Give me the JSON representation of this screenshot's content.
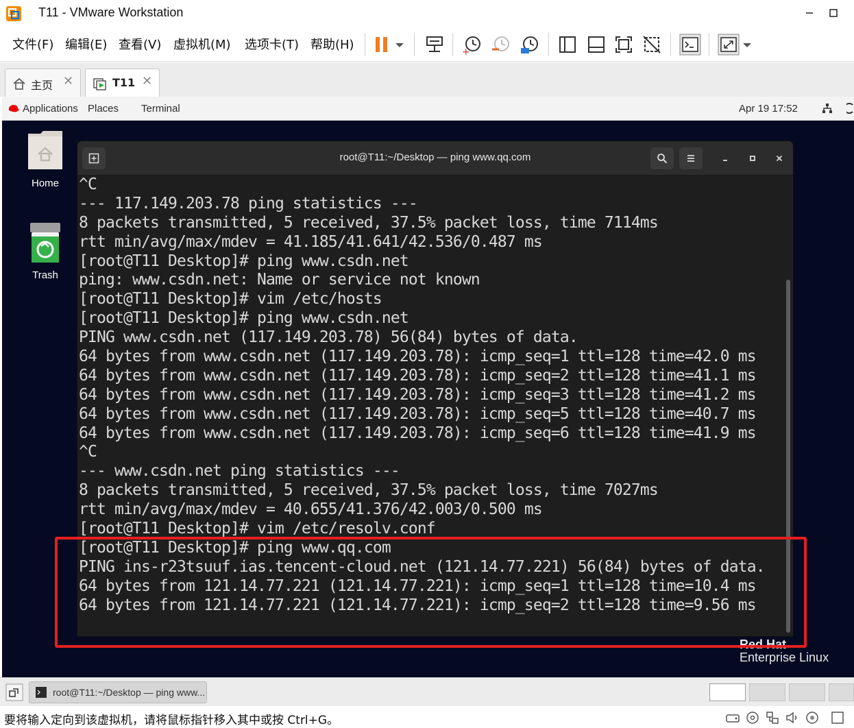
{
  "window": {
    "title": "T11 - VMware Workstation"
  },
  "menu": [
    "文件(F)",
    "编辑(E)",
    "查看(V)",
    "虚拟机(M)",
    "选项卡(T)",
    "帮助(H)"
  ],
  "tabs": [
    {
      "label": "主页"
    },
    {
      "label": "T11"
    }
  ],
  "guest_topbar": {
    "applications": "Applications",
    "places": "Places",
    "terminal": "Terminal",
    "datetime": "Apr 19  17:52"
  },
  "desktop": {
    "home_label": "Home",
    "trash_label": "Trash",
    "brand_line1": "Red Hat",
    "brand_line2": "Enterprise Linux"
  },
  "terminal": {
    "title": "root@T11:~/Desktop — ping www.qq.com",
    "lines": [
      "^C",
      "--- 117.149.203.78 ping statistics ---",
      "8 packets transmitted, 5 received, 37.5% packet loss, time 7114ms",
      "rtt min/avg/max/mdev = 41.185/41.641/42.536/0.487 ms",
      "[root@T11 Desktop]# ping www.csdn.net",
      "ping: www.csdn.net: Name or service not known",
      "[root@T11 Desktop]# vim /etc/hosts",
      "[root@T11 Desktop]# ping www.csdn.net",
      "PING www.csdn.net (117.149.203.78) 56(84) bytes of data.",
      "64 bytes from www.csdn.net (117.149.203.78): icmp_seq=1 ttl=128 time=42.0 ms",
      "64 bytes from www.csdn.net (117.149.203.78): icmp_seq=2 ttl=128 time=41.1 ms",
      "64 bytes from www.csdn.net (117.149.203.78): icmp_seq=3 ttl=128 time=41.2 ms",
      "64 bytes from www.csdn.net (117.149.203.78): icmp_seq=5 ttl=128 time=40.7 ms",
      "64 bytes from www.csdn.net (117.149.203.78): icmp_seq=6 ttl=128 time=41.9 ms",
      "^C",
      "--- www.csdn.net ping statistics ---",
      "8 packets transmitted, 5 received, 37.5% packet loss, time 7027ms",
      "rtt min/avg/max/mdev = 40.655/41.376/42.003/0.500 ms",
      "[root@T11 Desktop]# vim /etc/resolv.conf",
      "[root@T11 Desktop]# ping www.qq.com",
      "PING ins-r23tsuuf.ias.tencent-cloud.net (121.14.77.221) 56(84) bytes of data.",
      "64 bytes from 121.14.77.221 (121.14.77.221): icmp_seq=1 ttl=128 time=10.4 ms",
      "64 bytes from 121.14.77.221 (121.14.77.221): icmp_seq=2 ttl=128 time=9.56 ms"
    ]
  },
  "taskbar": {
    "task_label": "root@T11:~/Desktop — ping www..."
  },
  "statusbar": {
    "message": "要将输入定向到该虚拟机，请将鼠标指针移入其中或按 Ctrl+G。"
  },
  "colors": {
    "highlight": "#e51f1f",
    "pause_orange": "#f07d22",
    "desktop_bg": "#050a22"
  }
}
